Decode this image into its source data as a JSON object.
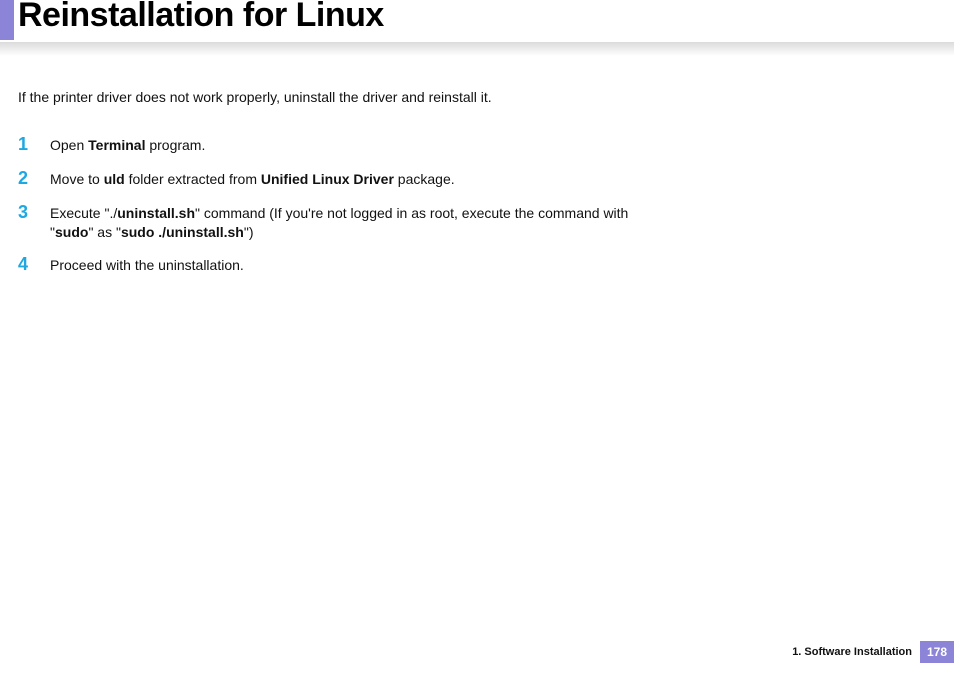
{
  "title": "Reinstallation for Linux",
  "intro": "If the printer driver does not work properly, uninstall the driver and reinstall it.",
  "steps": [
    {
      "num": "1",
      "html": "Open <b>Terminal</b> program."
    },
    {
      "num": "2",
      "html": "Move to <b>uld</b> folder extracted from <b>Unified Linux Driver</b> package."
    },
    {
      "num": "3",
      "html": "Execute \"./<b>uninstall.sh</b>\" command (If you're not logged in as root, execute the command with \"<b>sudo</b>\" as \"<b>sudo ./uninstall.sh</b>\")"
    },
    {
      "num": "4",
      "html": "Proceed with the uninstallation."
    }
  ],
  "footer": {
    "section": "1.  Software Installation",
    "page": "178"
  }
}
